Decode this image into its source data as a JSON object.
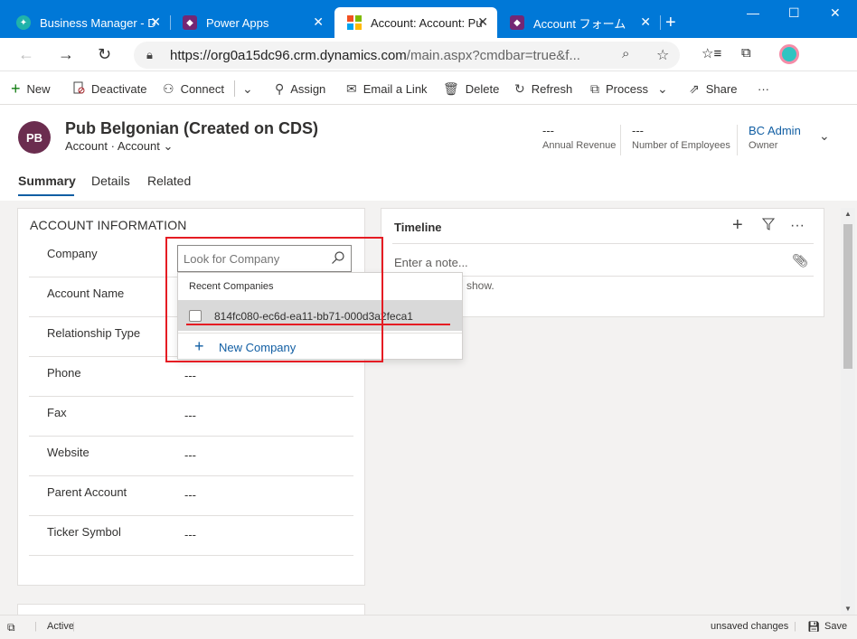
{
  "browser": {
    "tabs": [
      {
        "label": "Business Manager - D"
      },
      {
        "label": "Power Apps"
      },
      {
        "label": "Account: Account: Pu"
      },
      {
        "label": "Account フォーム"
      }
    ],
    "url_domain": "https://org0a15dc96.crm.dynamics.com",
    "url_path": "/main.aspx?cmdbar=true&f..."
  },
  "commands": {
    "new": "New",
    "deactivate": "Deactivate",
    "connect": "Connect",
    "assign": "Assign",
    "email_link": "Email a Link",
    "delete": "Delete",
    "refresh": "Refresh",
    "process": "Process",
    "share": "Share",
    "more": "···"
  },
  "record": {
    "initials": "PB",
    "title": "Pub Belgonian (Created on CDS)",
    "entity": "Account",
    "form": "Account",
    "annual_revenue_value": "---",
    "annual_revenue_label": "Annual Revenue",
    "employees_value": "---",
    "employees_label": "Number of Employees",
    "owner_value": "BC Admin",
    "owner_label": "Owner"
  },
  "form_tabs": [
    "Summary",
    "Details",
    "Related"
  ],
  "section": {
    "title": "ACCOUNT INFORMATION",
    "fields": [
      {
        "label": "Company",
        "value": ""
      },
      {
        "label": "Account Name",
        "value": ""
      },
      {
        "label": "Relationship Type",
        "value": ""
      },
      {
        "label": "Phone",
        "value": "---"
      },
      {
        "label": "Fax",
        "value": "---"
      },
      {
        "label": "Website",
        "value": "---"
      },
      {
        "label": "Parent Account",
        "value": "---"
      },
      {
        "label": "Ticker Symbol",
        "value": "---"
      }
    ]
  },
  "lookup": {
    "placeholder": "Look for Company",
    "recent_header": "Recent Companies",
    "recent_item": "814fc080-ec6d-ea11-bb71-000d3a2feca1",
    "new_label": "New Company"
  },
  "timeline": {
    "title": "Timeline",
    "note_placeholder": "Enter a note...",
    "empty_text": "show."
  },
  "status": {
    "state": "Active",
    "unsaved": "unsaved changes",
    "save": "Save"
  },
  "colors": {
    "accent": "#0078d7",
    "link": "#115ea3",
    "highlight": "#e51c23",
    "avatar": "#6b2d4f"
  }
}
